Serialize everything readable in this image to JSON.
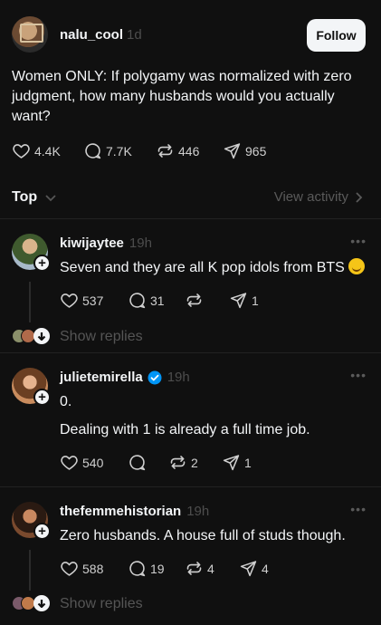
{
  "post": {
    "username": "nalu_cool",
    "time": "1d",
    "follow_label": "Follow",
    "text": "Women ONLY:  If polygamy was normalized with zero judgment, how many husbands would you actually want?",
    "likes": "4.4K",
    "comments": "7.7K",
    "reposts": "446",
    "shares": "965"
  },
  "sort": {
    "label": "Top",
    "view_activity": "View activity"
  },
  "replies": [
    {
      "username": "kiwijaytee",
      "time": "19h",
      "text": "Seven and they are all K pop idols from BTS",
      "likes": "537",
      "comments": "31",
      "reposts": "",
      "shares": "1",
      "show_replies": "Show replies"
    },
    {
      "username": "julietemirella",
      "time": "19h",
      "verified": true,
      "text_line1": "0.",
      "text_line2": "Dealing with 1 is already a full time job.",
      "likes": "540",
      "comments": "",
      "reposts": "2",
      "shares": "1"
    },
    {
      "username": "thefemmehistorian",
      "time": "19h",
      "text": "Zero husbands. A house full of studs though.",
      "likes": "588",
      "comments": "19",
      "reposts": "4",
      "shares": "4",
      "show_replies": "Show replies"
    }
  ],
  "icons": [
    "heart-icon",
    "comment-icon",
    "repost-icon",
    "share-icon",
    "chevron-down-icon",
    "chevron-right-icon",
    "more-icon",
    "verified-icon",
    "plus-icon"
  ],
  "colors": {
    "background": "#101010",
    "text": "#f3f5f7",
    "muted": "#4d4d4d",
    "verified": "#0095f6"
  }
}
